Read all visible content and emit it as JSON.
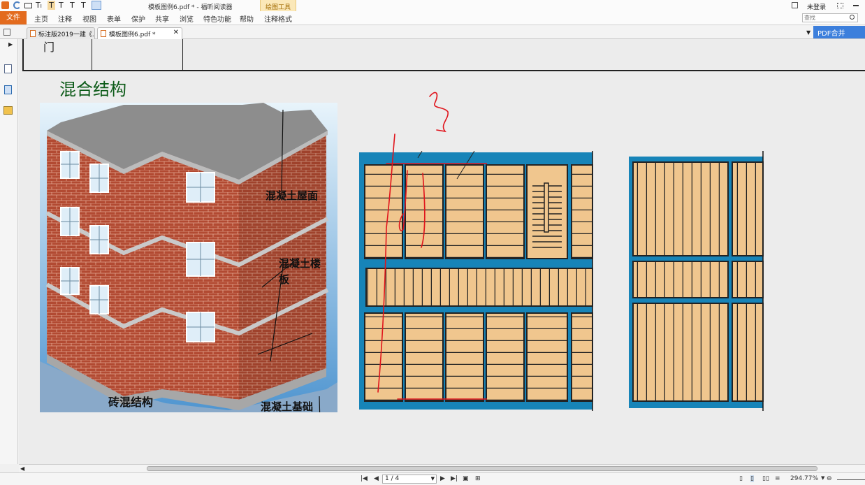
{
  "titlebar": {
    "title": "模板图例6.pdf * - 福昕阅读器",
    "context_tab": "绘图工具",
    "login": "未登录"
  },
  "menubar": {
    "file": "文件",
    "items": [
      "主页",
      "注释",
      "视图",
      "表单",
      "保护",
      "共享",
      "浏览",
      "特色功能",
      "帮助",
      "注释格式"
    ]
  },
  "search": {
    "placeholder": "查找"
  },
  "pdf_merge_label": "PDF合并",
  "tabs": [
    {
      "label": "标注版2019一建《..."
    },
    {
      "label": "模板图例6.pdf *"
    }
  ],
  "page": {
    "section_title": "混合结构",
    "building_labels": {
      "roof": "混凝土屋面",
      "floor_slab_1": "混凝土楼",
      "floor_slab_2": "板",
      "wall": "砖混结构",
      "foundation": "混凝土基础"
    },
    "annotation_number": "3"
  },
  "status": {
    "page_indicator": "1 / 4",
    "zoom": "294.77%"
  },
  "colors": {
    "accent_orange": "#e36b1e",
    "drawing_blue": "#1784b8",
    "slab_tan": "#f0c68e",
    "brick_red": "#b24a32",
    "annotation_red": "#e0141c",
    "title_green": "#0b5a17",
    "pdf_merge_blue": "#3c7fdc"
  }
}
